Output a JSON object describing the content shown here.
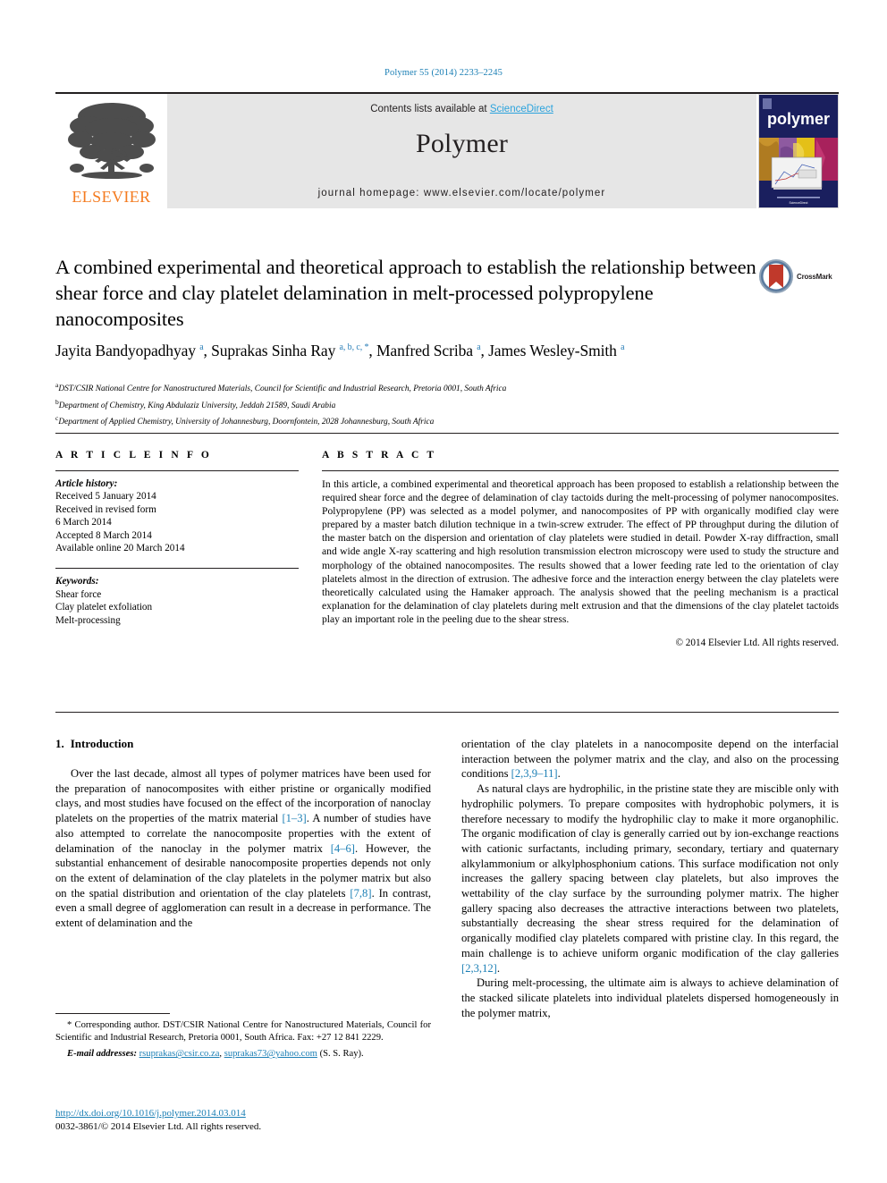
{
  "running_head": "Polymer 55 (2014) 2233–2245",
  "masthead": {
    "publisher": "ELSEVIER",
    "contents_prefix": "Contents lists available at ",
    "contents_link": "ScienceDirect",
    "journal_title": "Polymer",
    "homepage": "journal homepage: www.elsevier.com/locate/polymer",
    "cover_word": "polymer"
  },
  "crossmark": {
    "label": "CrossMark"
  },
  "article": {
    "title": "A combined experimental and theoretical approach to establish the relationship between shear force and clay platelet delamination in melt-processed polypropylene nanocomposites",
    "authors_html": "Jayita Bandyopadhyay <sup>a</sup>, Suprakas Sinha Ray <sup>a, b, c, *</sup>, Manfred Scriba <sup>a</sup>, James Wesley-Smith <sup>a</sup>",
    "affiliations": [
      {
        "marker": "a",
        "text": "DST/CSIR National Centre for Nanostructured Materials, Council for Scientific and Industrial Research, Pretoria 0001, South Africa"
      },
      {
        "marker": "b",
        "text": "Department of Chemistry, King Abdulaziz University, Jeddah 21589, Saudi Arabia"
      },
      {
        "marker": "c",
        "text": "Department of Applied Chemistry, University of Johannesburg, Doornfontein, 2028 Johannesburg, South Africa"
      }
    ]
  },
  "article_info": {
    "heading": "A R T I C L E  I N F O",
    "history_title": "Article history:",
    "history": [
      "Received 5 January 2014",
      "Received in revised form",
      "6 March 2014",
      "Accepted 8 March 2014",
      "Available online 20 March 2014"
    ],
    "keywords_title": "Keywords:",
    "keywords": [
      "Shear force",
      "Clay platelet exfoliation",
      "Melt-processing"
    ]
  },
  "abstract": {
    "heading": "A B S T R A C T",
    "text": "In this article, a combined experimental and theoretical approach has been proposed to establish a relationship between the required shear force and the degree of delamination of clay tactoids during the melt-processing of polymer nanocomposites. Polypropylene (PP) was selected as a model polymer, and nanocomposites of PP with organically modified clay were prepared by a master batch dilution technique in a twin-screw extruder. The effect of PP throughput during the dilution of the master batch on the dispersion and orientation of clay platelets were studied in detail. Powder X-ray diffraction, small and wide angle X-ray scattering and high resolution transmission electron microscopy were used to study the structure and morphology of the obtained nanocomposites. The results showed that a lower feeding rate led to the orientation of clay platelets almost in the direction of extrusion. The adhesive force and the interaction energy between the clay platelets were theoretically calculated using the Hamaker approach. The analysis showed that the peeling mechanism is a practical explanation for the delamination of clay platelets during melt extrusion and that the dimensions of the clay platelet tactoids play an important role in the peeling due to the shear stress.",
    "copyright": "© 2014 Elsevier Ltd. All rights reserved."
  },
  "introduction": {
    "number": "1.",
    "heading": "Introduction",
    "left_paragraphs": [
      "Over the last decade, almost all types of polymer matrices have been used for the preparation of nanocomposites with either pristine or organically modified clays, and most studies have focused on the effect of the incorporation of nanoclay platelets on the properties of the matrix material [1–3]. A number of studies have also attempted to correlate the nanocomposite properties with the extent of delamination of the nanoclay in the polymer matrix [4–6]. However, the substantial enhancement of desirable nanocomposite properties depends not only on the extent of delamination of the clay platelets in the polymer matrix but also on the spatial distribution and orientation of the clay platelets [7,8]. In contrast, even a small degree of agglomeration can result in a decrease in performance. The extent of delamination and the"
    ],
    "right_paragraphs": [
      "orientation of the clay platelets in a nanocomposite depend on the interfacial interaction between the polymer matrix and the clay, and also on the processing conditions [2,3,9–11].",
      "As natural clays are hydrophilic, in the pristine state they are miscible only with hydrophilic polymers. To prepare composites with hydrophobic polymers, it is therefore necessary to modify the hydrophilic clay to make it more organophilic. The organic modification of clay is generally carried out by ion-exchange reactions with cationic surfactants, including primary, secondary, tertiary and quaternary alkylammonium or alkylphosphonium cations. This surface modification not only increases the gallery spacing between clay platelets, but also improves the wettability of the clay surface by the surrounding polymer matrix. The higher gallery spacing also decreases the attractive interactions between two platelets, substantially decreasing the shear stress required for the delamination of organically modified clay platelets compared with pristine clay. In this regard, the main challenge is to achieve uniform organic modification of the clay galleries [2,3,12].",
      "During melt-processing, the ultimate aim is always to achieve delamination of the stacked silicate platelets into individual platelets dispersed homogeneously in the polymer matrix,"
    ]
  },
  "footnotes": {
    "corresponding": "* Corresponding author. DST/CSIR National Centre for Nanostructured Materials, Council for Scientific and Industrial Research, Pretoria 0001, South Africa. Fax: +27 12 841 2229.",
    "email_label": "E-mail addresses:",
    "email_1": "rsuprakas@csir.co.za",
    "email_2": "suprakas73@yahoo.com",
    "email_suffix": "(S. S. Ray)."
  },
  "doi_block": {
    "doi": "http://dx.doi.org/10.1016/j.polymer.2014.03.014",
    "issn": "0032-3861/© 2014 Elsevier Ltd. All rights reserved."
  },
  "colors": {
    "link_blue": "#1b7fb5",
    "sciencedirect_blue": "#2ba3dd",
    "elsevier_orange": "#f47b20",
    "band_grey": "#e6e6e6",
    "cover_navy": "#1a1f5e"
  }
}
